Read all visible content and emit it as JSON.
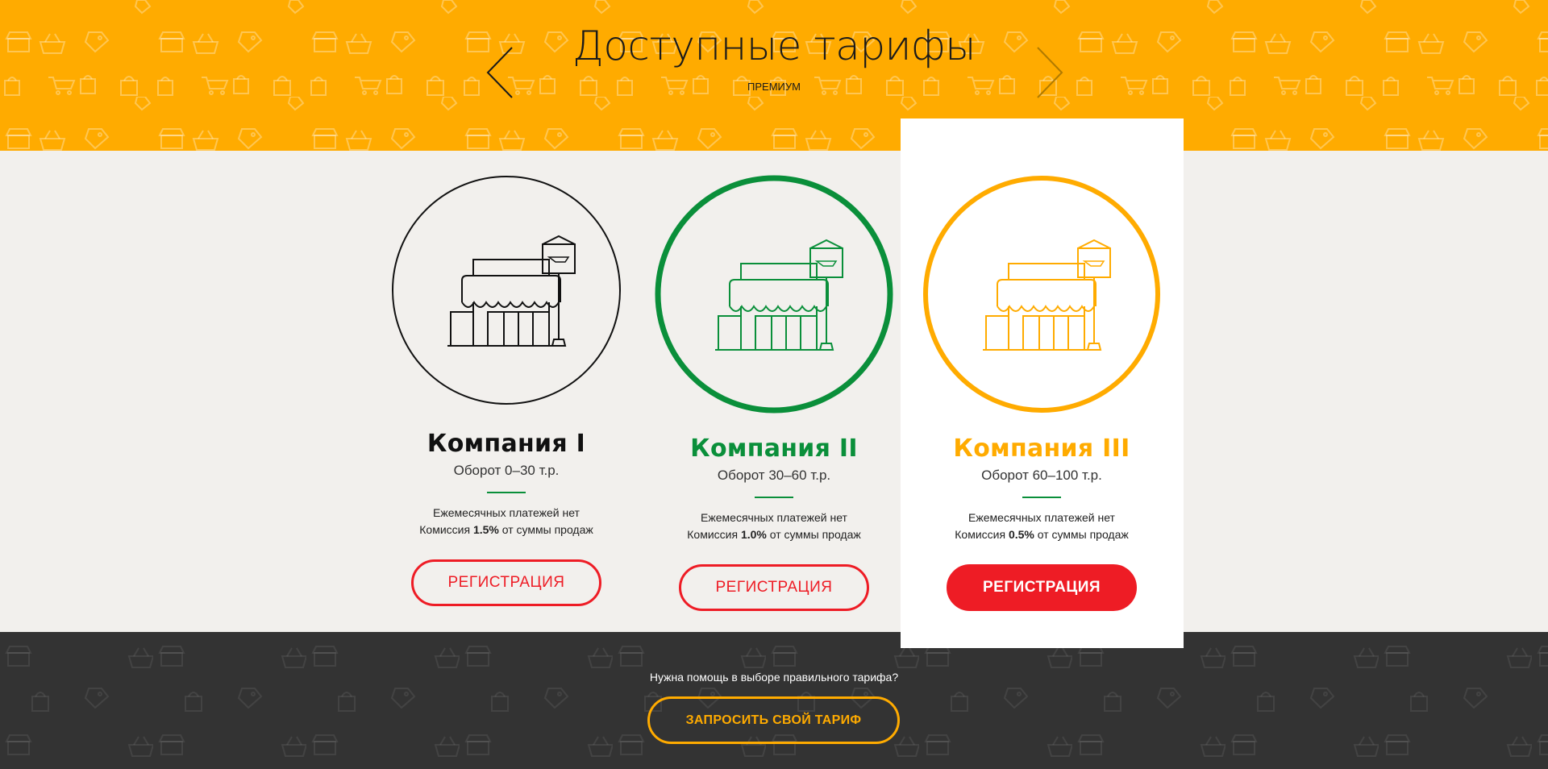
{
  "header": {
    "title": "Доступные тарифы",
    "subtitle": "ПРЕМИУМ",
    "prev_icon": "chevron-left-icon",
    "next_icon": "chevron-right-icon",
    "background_color": "#ffab00"
  },
  "plans": [
    {
      "name": "Компания I",
      "turnover": "Оборот 0–30 т.р.",
      "monthly": "Ежемесячных платежей нет",
      "commission_prefix": "Комиссия",
      "commission_value": "1.5%",
      "commission_suffix": "от суммы продаж",
      "button_label": "РЕГИСТРАЦИЯ",
      "color": "#111111",
      "icon": "shop-icon"
    },
    {
      "name": "Компания II",
      "turnover": "Оборот 30–60 т.р.",
      "monthly": "Ежемесячных платежей нет",
      "commission_prefix": "Комиссия",
      "commission_value": "1.0%",
      "commission_suffix": "от суммы продаж",
      "button_label": "РЕГИСТРАЦИЯ",
      "color": "#0a8f3a",
      "icon": "shop-icon"
    },
    {
      "name": "Компания III",
      "turnover": "Оборот 60–100 т.р.",
      "monthly": "Ежемесячных платежей нет",
      "commission_prefix": "Комиссия",
      "commission_value": "0.5%",
      "commission_suffix": "от суммы продаж",
      "button_label": "РЕГИСТРАЦИЯ",
      "color": "#ffab00",
      "icon": "shop-icon"
    }
  ],
  "colors": {
    "accent_red": "#ee1c25",
    "divider_green": "#0a8f3a",
    "footer_bg": "#333333"
  },
  "footer": {
    "help_text": "Нужна помощь в выборе правильного тарифа?",
    "button_label": "ЗАПРОСИТЬ СВОЙ ТАРИФ"
  }
}
